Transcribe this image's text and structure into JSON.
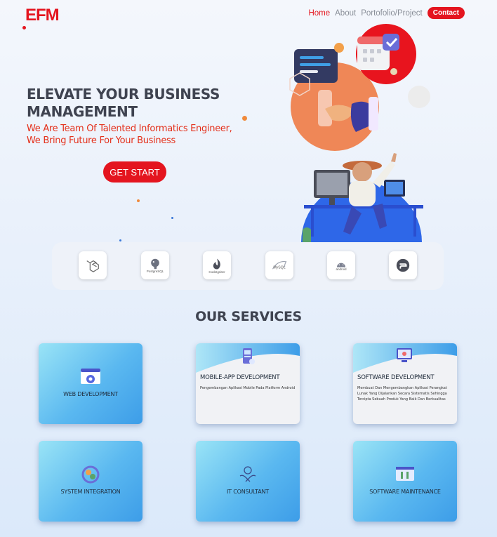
{
  "header": {
    "logo": "EFM",
    "nav": [
      "Home",
      "About",
      "Portofolio/Project"
    ],
    "contact_label": "Contact",
    "colors": {
      "brand": "#e4151f"
    }
  },
  "hero": {
    "title": "ELEVATE YOUR BUSINESS MANAGEMENT",
    "subtitle": "We Are Team Of Talented Informatics Engineer, We Bring Future For Your Business",
    "cta_label": "GET START"
  },
  "tech_stack": [
    {
      "icon": "laravel-icon",
      "caption": ""
    },
    {
      "icon": "postgresql-icon",
      "caption": "PostgreSQL"
    },
    {
      "icon": "codeigniter-icon",
      "caption": "CodeIgniter"
    },
    {
      "icon": "mysql-icon",
      "caption": "MySQL"
    },
    {
      "icon": "android-icon",
      "caption": "android"
    },
    {
      "icon": "python-icon",
      "caption": ""
    }
  ],
  "services": {
    "title": "OUR SERVICES",
    "items": [
      {
        "label": "WEB DEVELOPMENT",
        "icon": "web-development-icon"
      },
      {
        "label": "MOBILE-APP DEVELOPMENT",
        "icon": "mobile-app-icon",
        "description": "Pengembangan Aplikasi Mobile Pada Platform Android"
      },
      {
        "label": "SOFTWARE DEVELOPMENT",
        "icon": "software-development-icon",
        "description": "Membuat Dan Mengembangkan Aplikasi Perangkat Lunak Yang Dijalankan Secara Sistematis Sehingga Tercipta Sebuah Produk Yang Baik Dan Berkualitas"
      },
      {
        "label": "SYSTEM INTEGRATION",
        "icon": "system-integration-icon"
      },
      {
        "label": "IT CONSULTANT",
        "icon": "it-consultant-icon"
      },
      {
        "label": "SOFTWARE MAINTENANCE",
        "icon": "software-maintenance-icon"
      }
    ]
  }
}
